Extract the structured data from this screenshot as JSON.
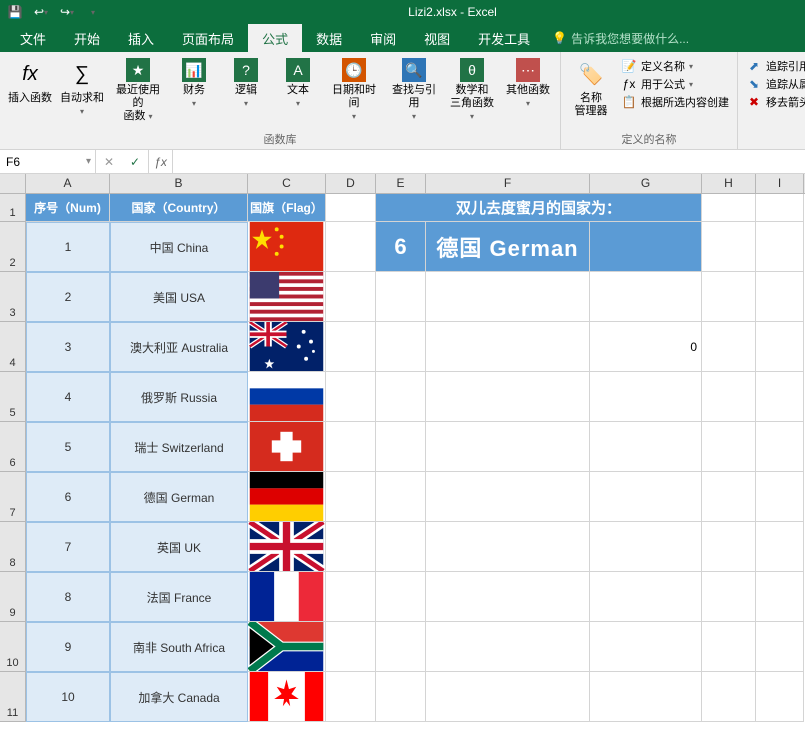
{
  "title": "Lizi2.xlsx - Excel",
  "qat": {
    "save": "💾",
    "undo": "↩",
    "redo": "↪"
  },
  "tabs": {
    "file": "文件",
    "home": "开始",
    "insert": "插入",
    "layout": "页面布局",
    "formulas": "公式",
    "data": "数据",
    "review": "审阅",
    "view": "视图",
    "dev": "开发工具",
    "tellme": "告诉我您想要做什么..."
  },
  "ribbon": {
    "insertFn": "插入函数",
    "autosum": "自动求和",
    "recent": "最近使用的\n函数",
    "financial": "财务",
    "logical": "逻辑",
    "text": "文本",
    "datetime": "日期和时间",
    "lookup": "查找与引用",
    "math": "数学和\n三角函数",
    "other": "其他函数",
    "lib_label": "函数库",
    "nameMgr": "名称\n管理器",
    "defineName": "定义名称",
    "useInFormula": "用于公式",
    "createFromSel": "根据所选内容创建",
    "names_label": "定义的名称",
    "tracePrec": "追踪引用",
    "traceDep": "追踪从属",
    "removeArrow": "移去箭头"
  },
  "namebox": "F6",
  "formula": "",
  "headers": {
    "A": "序号（Num)",
    "B": "国家（Country）",
    "C": "国旗（Flag）"
  },
  "rows": [
    {
      "num": "1",
      "country": "中国 China",
      "flag": "china"
    },
    {
      "num": "2",
      "country": "美国 USA",
      "flag": "usa"
    },
    {
      "num": "3",
      "country": "澳大利亚 Australia",
      "flag": "australia"
    },
    {
      "num": "4",
      "country": "俄罗斯 Russia",
      "flag": "russia"
    },
    {
      "num": "5",
      "country": "瑞士 Switzerland",
      "flag": "switzerland"
    },
    {
      "num": "6",
      "country": "德国 German",
      "flag": "germany"
    },
    {
      "num": "7",
      "country": "英国 UK",
      "flag": "uk"
    },
    {
      "num": "8",
      "country": "法国 France",
      "flag": "france"
    },
    {
      "num": "9",
      "country": "南非 South Africa",
      "flag": "southafrica"
    },
    {
      "num": "10",
      "country": "加拿大 Canada",
      "flag": "canada"
    }
  ],
  "banner": "双儿去度蜜月的国家为：",
  "result": {
    "num": "6",
    "country": "德国 German"
  },
  "zeroCell": "0"
}
